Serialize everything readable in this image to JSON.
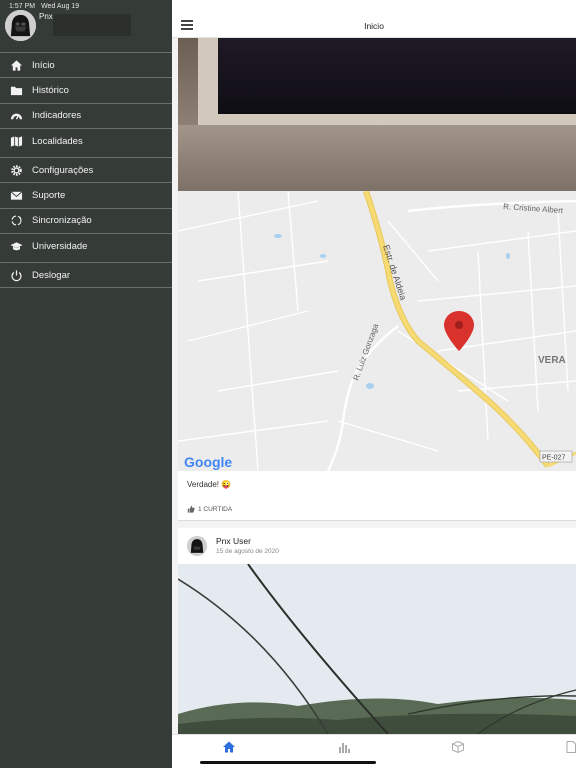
{
  "status": {
    "time": "1:57 PM",
    "date": "Wed Aug 19"
  },
  "profile": {
    "name": "Pnx"
  },
  "sidebar": {
    "items": [
      {
        "label": "Início",
        "icon": "home-icon"
      },
      {
        "label": "Histórico",
        "icon": "folder-icon"
      },
      {
        "label": "Indicadores",
        "icon": "gauge-icon"
      },
      {
        "label": "Localidades",
        "icon": "map-icon"
      },
      {
        "label": "Configurações",
        "icon": "gear-icon"
      },
      {
        "label": "Suporte",
        "icon": "envelope-icon"
      },
      {
        "label": "Sincronização",
        "icon": "sync-icon"
      },
      {
        "label": "Universidade",
        "icon": "graduation-cap-icon"
      },
      {
        "label": "Deslogar",
        "icon": "power-icon"
      }
    ]
  },
  "header": {
    "title": "Inicio"
  },
  "map": {
    "labels": {
      "street1": "R. Cristine Albert",
      "street2": "Estr. de Aldeia",
      "street3": "R. Luiz Gonzaga",
      "district": "VERA",
      "highway": "PE-027"
    },
    "brand": "Google"
  },
  "post1": {
    "caption": "Verdade! 😜",
    "likes": "1 CURTIDA"
  },
  "post2": {
    "author": "Pnx User",
    "date": "15 de agosto de 2020"
  },
  "tabbar": {
    "items": [
      "home-icon",
      "bar-chart-icon",
      "cube-icon",
      "document-icon"
    ],
    "active_color": "#2f6fdd"
  },
  "colors": {
    "sidebar_bg": "#353b37",
    "map_pin": "#d9312b",
    "highway": "#f1d36b"
  }
}
